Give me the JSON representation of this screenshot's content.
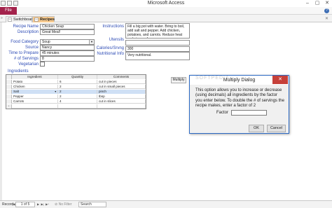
{
  "window": {
    "title": "Microsoft Access",
    "controls": [
      "–",
      "▢",
      "✕"
    ]
  },
  "ribbon": {
    "file_label": "File",
    "help_icon": "?"
  },
  "doc_tabs": {
    "toggle": "»",
    "switchboard": "Switchboard",
    "recipes": "Recipes",
    "close": "✕"
  },
  "form": {
    "recipe_name_label": "Recipe Name",
    "recipe_name": "Chicken Soup",
    "description_label": "Description",
    "description": "Great Meal!",
    "food_category_label": "Food Category",
    "food_category": "Soup",
    "source_label": "Source",
    "source": "Nancy",
    "time_label": "Time to Prepare",
    "time": "45 minutes",
    "servings_label": "# of Servings",
    "servings": "8",
    "vegetarian_label": "Vegetarian",
    "instructions_label": "Instructions",
    "instructions": "Fill a big pot with water. Bring to boil, add salt and pepper. Add chicken, potatoes, and carrots. Reduce heat and simmer for",
    "utensils_label": "Utensils",
    "calories_label": "Calories/Srvng",
    "calories": "300",
    "nutritional_label": "Nutritional Info",
    "nutritional": "Very nutritional.",
    "ingredients_label": "Ingredients"
  },
  "grid": {
    "headers": [
      "Ingredient",
      "Quantity",
      "Comments"
    ],
    "rows": [
      {
        "ingredient": "Potato",
        "quantity": "6",
        "comments": "cut in pieces"
      },
      {
        "ingredient": "Chicken",
        "quantity": "2",
        "comments": "cut in small pieces"
      },
      {
        "ingredient": "Salt",
        "quantity": "2",
        "comments": "pinch"
      },
      {
        "ingredient": "Pepper",
        "quantity": "2",
        "comments": "tbsp"
      },
      {
        "ingredient": "Carrots",
        "quantity": "4",
        "comments": "cut in slices"
      }
    ],
    "selected_row": 2,
    "new_row_marker": "*"
  },
  "multiply_button": "Multiply",
  "dialog": {
    "title": "Multiply Dialog",
    "close": "✕",
    "description": "This option allows you to increase or decrease (using decimals) all ingredients by the factor you enter below. To double the # of servings the recipe makes, enter a factor of 2",
    "factor_label": "Factor",
    "factor_value": "",
    "ok": "OK",
    "cancel": "Cancel"
  },
  "watermark": "SOFTPEDIA",
  "record_bar": {
    "label": "Record:",
    "position": "1 of 5",
    "filter": "No Filter",
    "search_placeholder": "Search"
  },
  "colors": {
    "file_tab": "#a3224b",
    "label_blue": "#2d4bb5",
    "active_tab": "#f6c98e",
    "dialog_close": "#c6403a"
  }
}
